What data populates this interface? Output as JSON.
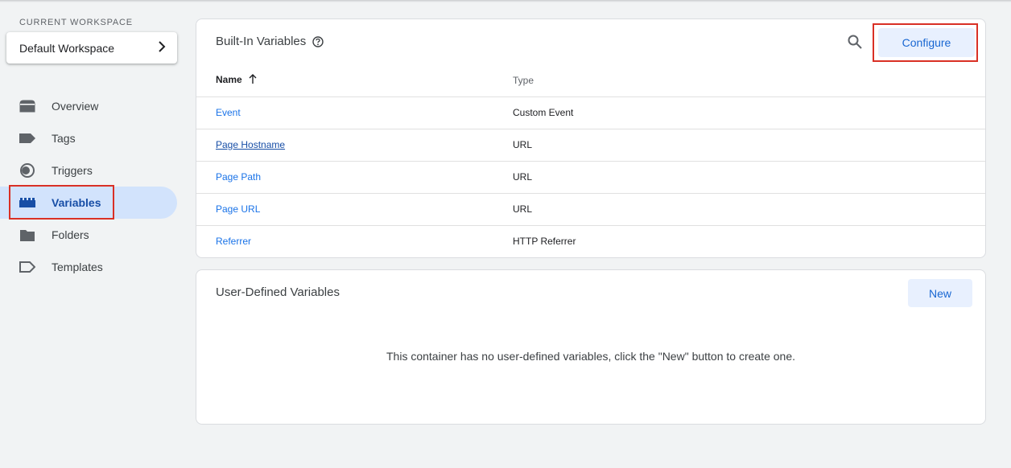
{
  "sidebar": {
    "workspace_label": "CURRENT WORKSPACE",
    "workspace_name": "Default Workspace",
    "items": [
      {
        "label": "Overview",
        "icon": "overview-icon"
      },
      {
        "label": "Tags",
        "icon": "tag-icon"
      },
      {
        "label": "Triggers",
        "icon": "trigger-icon"
      },
      {
        "label": "Variables",
        "icon": "variables-icon",
        "active": true
      },
      {
        "label": "Folders",
        "icon": "folder-icon"
      },
      {
        "label": "Templates",
        "icon": "template-icon"
      }
    ]
  },
  "builtin": {
    "title": "Built-In Variables",
    "configure_label": "Configure",
    "columns": {
      "name": "Name",
      "type": "Type"
    },
    "rows": [
      {
        "name": "Event",
        "type": "Custom Event"
      },
      {
        "name": "Page Hostname",
        "type": "URL"
      },
      {
        "name": "Page Path",
        "type": "URL"
      },
      {
        "name": "Page URL",
        "type": "URL"
      },
      {
        "name": "Referrer",
        "type": "HTTP Referrer"
      }
    ]
  },
  "userdefined": {
    "title": "User-Defined Variables",
    "new_label": "New",
    "empty_message": "This container has no user-defined variables, click the \"New\" button to create one."
  },
  "colors": {
    "accent": "#1a73e8",
    "active_bg": "#d2e3fc",
    "highlight": "#d93025"
  }
}
